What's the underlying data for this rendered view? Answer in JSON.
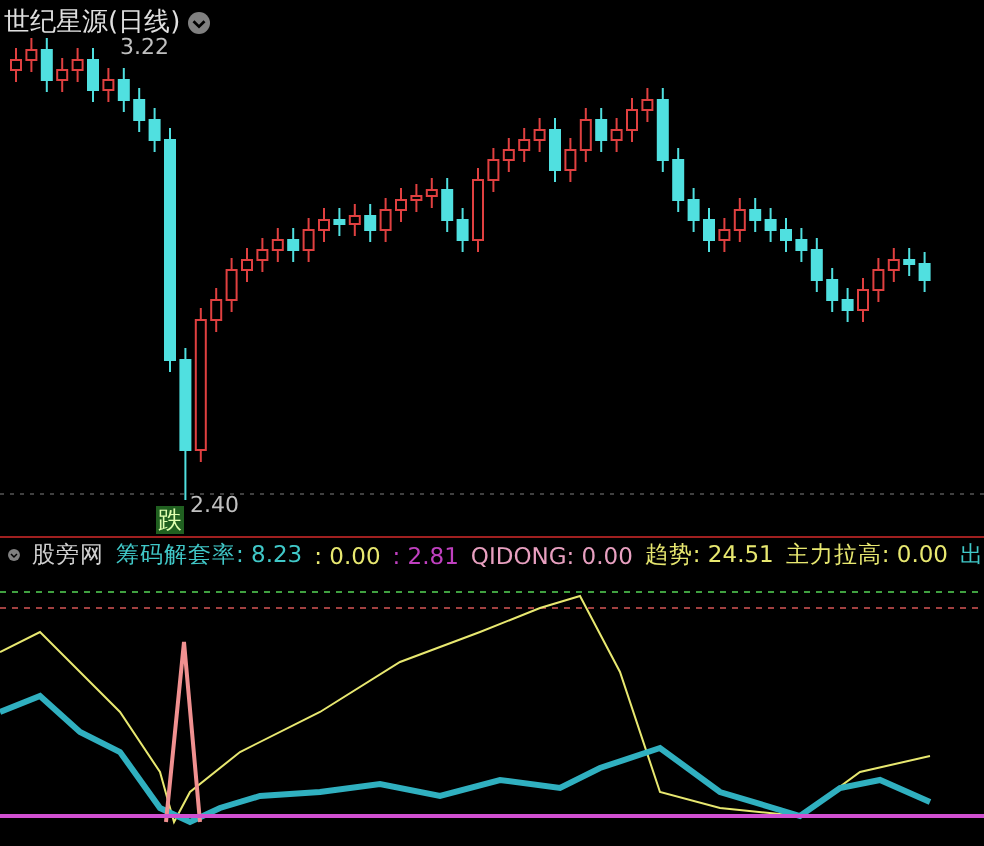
{
  "title": "世纪星源(日线)",
  "price_chart": {
    "high_label": "3.22",
    "low_label": "2.40",
    "marker": "跌"
  },
  "indicator": {
    "name": "股旁网",
    "items": [
      {
        "text": "筹码解套率: 8.23",
        "color": "#40c8c8"
      },
      {
        "text": ": 0.00",
        "color": "#e8e870"
      },
      {
        "text": ": 2.81",
        "color": "#c040c0"
      },
      {
        "text": "QIDONG: 0.00",
        "color": "#e8a0c0"
      },
      {
        "text": "趋势: 24.51",
        "color": "#e8e870"
      },
      {
        "text": "主力拉高: 0.00",
        "color": "#e8e870"
      },
      {
        "text": "出",
        "color": "#40c8c8"
      }
    ]
  }
}
